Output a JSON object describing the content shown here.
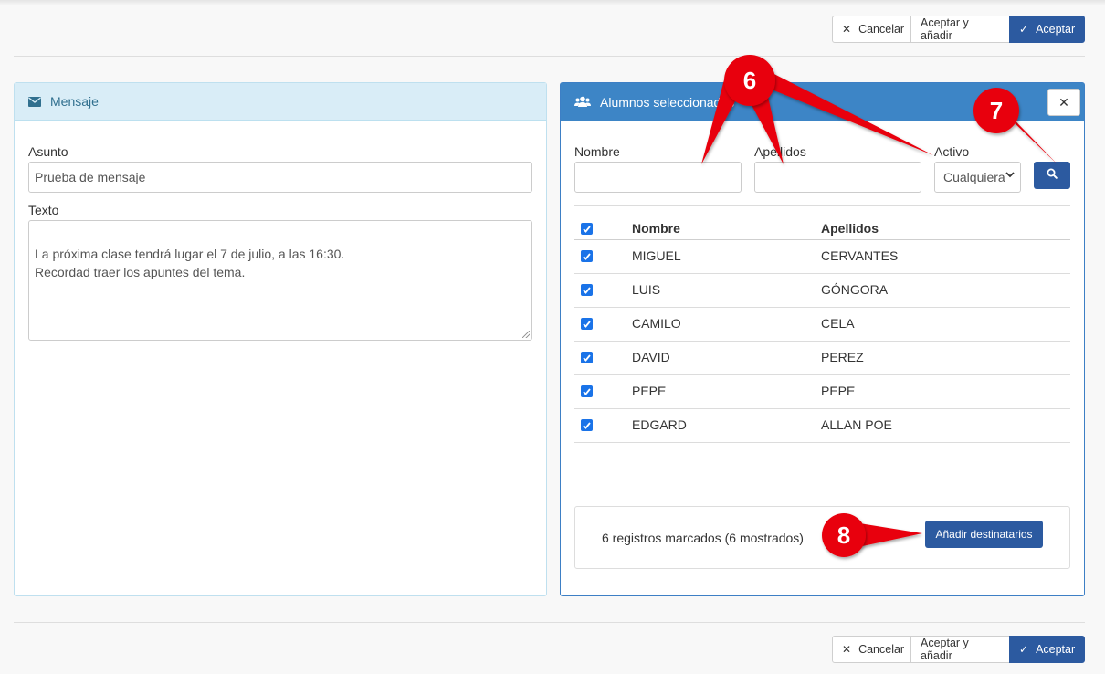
{
  "actions": {
    "cancel_label": "Cancelar",
    "accept_add_label": "Aceptar y añadir",
    "accept_label": "Aceptar"
  },
  "message_panel": {
    "title": "Mensaje",
    "subject_label": "Asunto",
    "subject_value": "Prueba de mensaje",
    "text_label": "Texto",
    "text_value": "La próxima clase tendrá lugar el 7 de julio, a las 16:30.\nRecordad traer los apuntes del tema."
  },
  "students_panel": {
    "title": "Alumnos seleccionados",
    "filters": {
      "name_label": "Nombre",
      "name_value": "",
      "surname_label": "Apellidos",
      "surname_value": "",
      "active_label": "Activo",
      "active_selected": "Cualquiera"
    },
    "table": {
      "headers": [
        "Nombre",
        "Apellidos"
      ],
      "rows": [
        {
          "nombre": "MIGUEL",
          "apellidos": "CERVANTES",
          "checked": true
        },
        {
          "nombre": "LUIS",
          "apellidos": "GÓNGORA",
          "checked": true
        },
        {
          "nombre": "CAMILO",
          "apellidos": "CELA",
          "checked": true
        },
        {
          "nombre": "DAVID",
          "apellidos": "PEREZ",
          "checked": true
        },
        {
          "nombre": "PEPE",
          "apellidos": "PEPE",
          "checked": true
        },
        {
          "nombre": "EDGARD",
          "apellidos": "ALLAN POE",
          "checked": true
        }
      ]
    },
    "footer_status": "6 registros marcados (6 mostrados)",
    "add_recipients_label": "Añadir destinatarios"
  },
  "callouts": {
    "c6": "6",
    "c7": "7",
    "c8": "8"
  },
  "colors": {
    "primary": "#2c5aa0",
    "panel_header_blue": "#3d85c6",
    "info_header": "#d9edf7",
    "callout_red": "#e8000b"
  },
  "icons": {
    "cancel": "close-icon",
    "accept": "check-icon",
    "message": "envelope-icon",
    "students": "users-icon",
    "search": "search-icon",
    "close_panel": "close-icon"
  }
}
